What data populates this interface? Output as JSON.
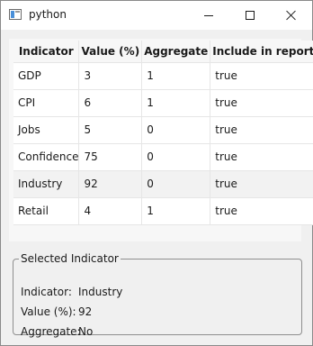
{
  "window": {
    "title": "python"
  },
  "table": {
    "headers": [
      "Indicator",
      "Value (%)",
      "Aggregate",
      "Include in report"
    ],
    "rows": [
      [
        "GDP",
        "3",
        "1",
        "true"
      ],
      [
        "CPI",
        "6",
        "1",
        "true"
      ],
      [
        "Jobs",
        "5",
        "0",
        "true"
      ],
      [
        "Confidence",
        "75",
        "0",
        "true"
      ],
      [
        "Industry",
        "92",
        "0",
        "true"
      ],
      [
        "Retail",
        "4",
        "1",
        "true"
      ]
    ],
    "selected_row": "Industry"
  },
  "details": {
    "group_title": "Selected Indicator",
    "indicator_label": "Indicator:",
    "indicator_value": "Industry",
    "value_label": "Value (%):",
    "value_value": "92",
    "aggregate_label": "Aggregate:",
    "aggregate_value": "No"
  }
}
